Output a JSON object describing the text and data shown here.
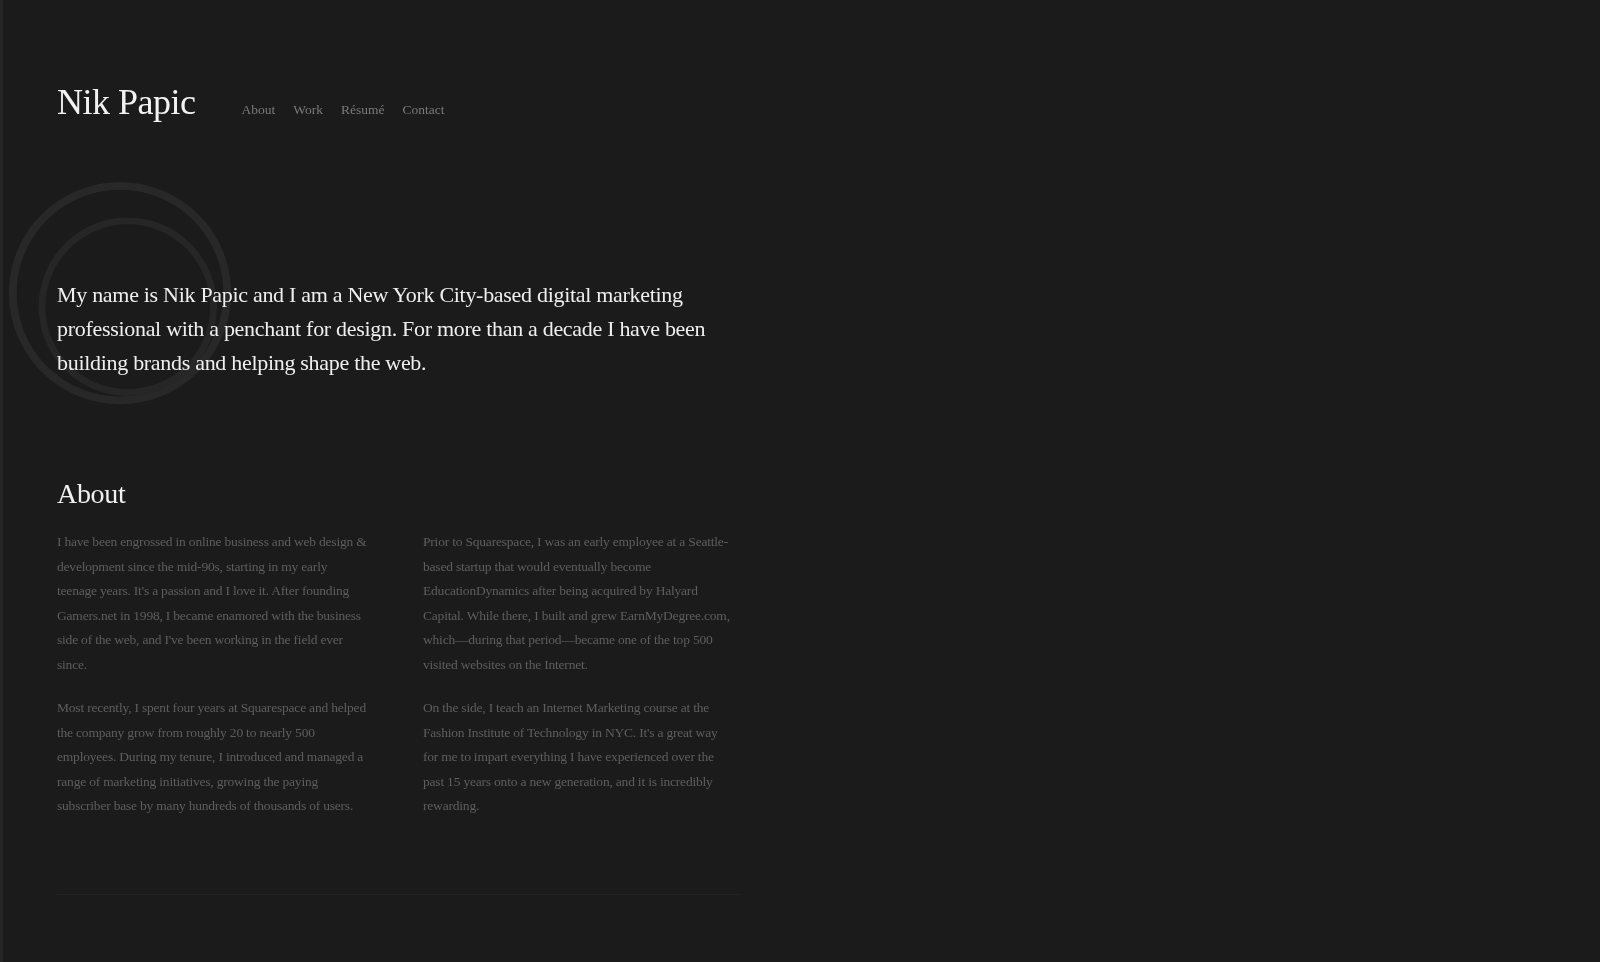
{
  "header": {
    "site_title": "Nik Papic",
    "nav": [
      {
        "label": "About"
      },
      {
        "label": "Work"
      },
      {
        "label": "Résumé"
      },
      {
        "label": "Contact"
      }
    ]
  },
  "intro": "My name is Nik Papic and I am a New York City-based digital marketing professional with a penchant for design. For more than a decade I have been building brands and helping shape the web.",
  "about": {
    "heading": "About",
    "columns": [
      [
        "I have been engrossed in online business and web design & development since the mid-90s, starting in my early teenage years. It's a passion and I love it. After founding Gamers.net in 1998, I became enamored with the business side of the web, and I've been working in the field ever since.",
        "Most recently, I spent four years at Squarespace and helped the company grow from roughly 20 to nearly 500 employees. During my tenure, I introduced and managed a range of marketing initiatives, growing the paying subscriber base by many hundreds of thousands of users."
      ],
      [
        "Prior to Squarespace, I was an early employee at a Seattle-based startup that would eventually become EducationDynamics after being acquired by Halyard Capital. While there, I built and grew EarnMyDegree.com, which—during that period—became one of the top 500 visited websites on the Internet.",
        "On the side, I teach an Internet Marketing course at the Fashion Institute of Technology in NYC. It's a great way for me to impart everything I have experienced over the past 15 years onto a new generation, and it is incredibly rewarding."
      ]
    ]
  }
}
